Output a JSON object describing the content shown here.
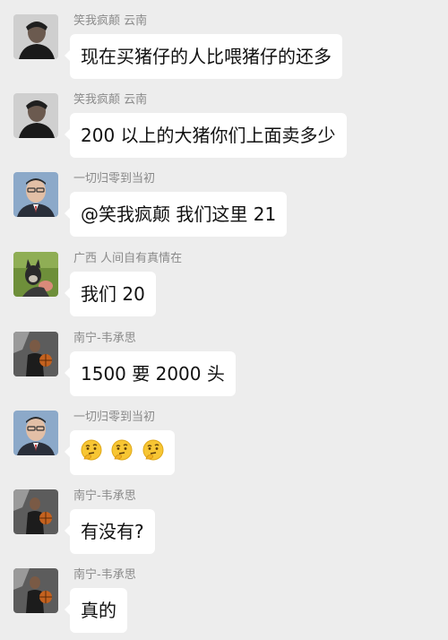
{
  "messages": [
    {
      "sender": "笑我疯颠 云南",
      "text": "现在买猪仔的人比喂猪仔的还多",
      "avatar": "avatar-man-dark"
    },
    {
      "sender": "笑我疯颠 云南",
      "text": "200 以上的大猪你们上面卖多少",
      "avatar": "avatar-man-dark"
    },
    {
      "sender": "一切归零到当初",
      "text": "@笑我疯颠  我们这里 21",
      "avatar": "avatar-man-glasses"
    },
    {
      "sender": "广西 人间自有真情在",
      "text": "我们 20",
      "avatar": "avatar-dog"
    },
    {
      "sender": "南宁-韦承思",
      "text": "1500 要 2000 头",
      "avatar": "avatar-man-ball"
    },
    {
      "sender": "一切归零到当初",
      "text": "",
      "emoji": [
        "thinking-face-icon",
        "thinking-face-icon",
        "thinking-face-icon"
      ],
      "avatar": "avatar-man-glasses"
    },
    {
      "sender": "南宁-韦承思",
      "text": "有没有?",
      "avatar": "avatar-man-ball"
    },
    {
      "sender": "南宁-韦承思",
      "text": "真的",
      "avatar": "avatar-man-ball"
    }
  ],
  "colors": {
    "background": "#ededed",
    "bubble": "#ffffff",
    "sender_name": "#8a8a8a",
    "message_text": "#111111"
  }
}
